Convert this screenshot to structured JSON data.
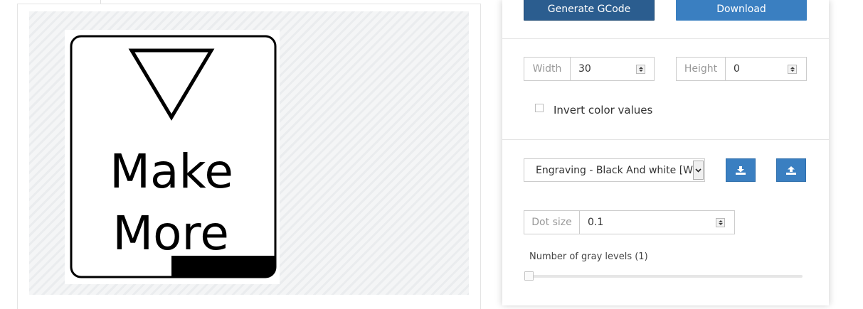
{
  "toolbar": {
    "generate_label": "Generate GCode",
    "download_label": "Download"
  },
  "preview": {
    "sign_line1": "Make",
    "sign_line2": "More"
  },
  "size": {
    "width_label": "Width",
    "width_value": "30",
    "height_label": "Height",
    "height_value": "0"
  },
  "options": {
    "invert_label": "Invert color values",
    "invert_checked": false
  },
  "preset": {
    "selected": "Engraving - Black And white [Wo",
    "download_icon": "download-icon",
    "upload_icon": "upload-icon"
  },
  "engraving": {
    "dot_size_label": "Dot size",
    "dot_size_value": "0.1",
    "gray_levels_label": "Number of gray levels (1)",
    "gray_levels_value": 1
  },
  "colors": {
    "primary_dark": "#2b5d8f",
    "primary": "#3a7fc1"
  }
}
